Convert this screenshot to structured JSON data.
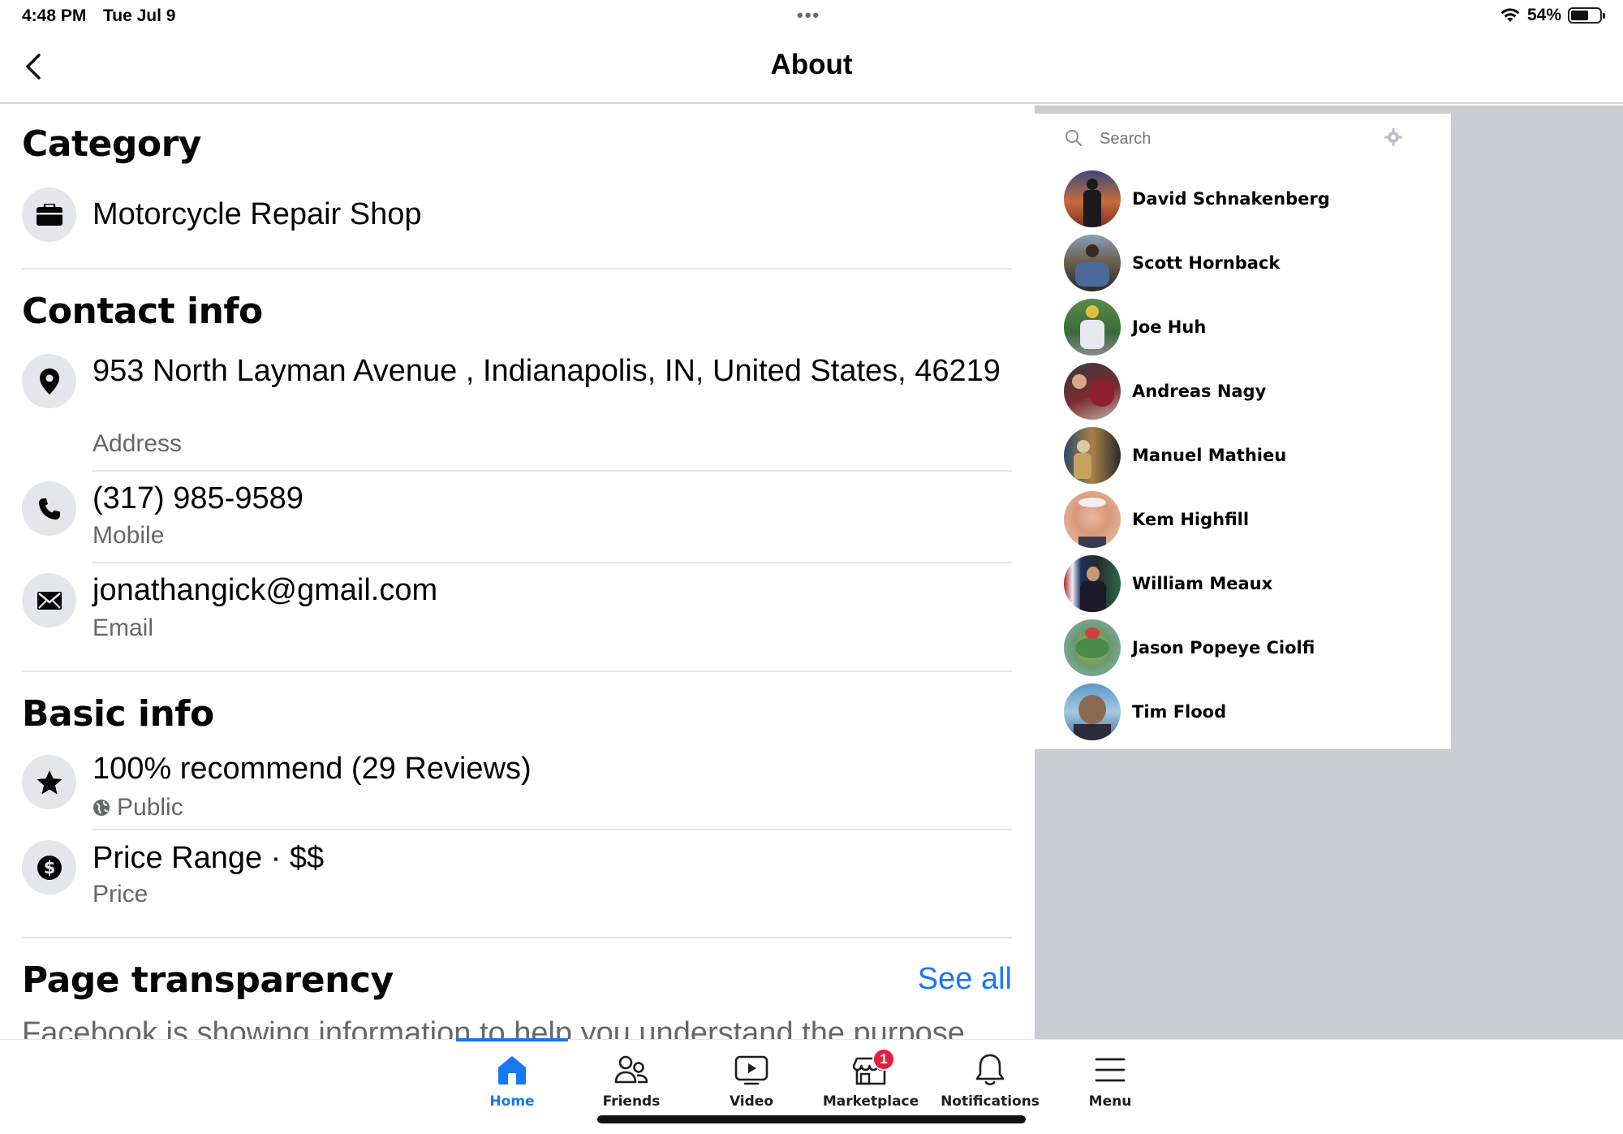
{
  "status_bar": {
    "time": "4:48 PM",
    "date": "Tue Jul 9",
    "battery": "54%"
  },
  "header": {
    "title": "About"
  },
  "category": {
    "title": "Category",
    "value": "Motorcycle Repair Shop"
  },
  "contact": {
    "title": "Contact info",
    "address": "953 North Layman Avenue , Indianapolis, IN, United States, 46219",
    "address_label": "Address",
    "phone": "(317) 985-9589",
    "phone_label": "Mobile",
    "email": "jonathangick@gmail.com",
    "email_label": "Email"
  },
  "basic": {
    "title": "Basic info",
    "rating": "100% recommend (29 Reviews)",
    "rating_label": "Public",
    "price": "Price Range · $$",
    "price_label": "Price"
  },
  "transparency": {
    "title": "Page transparency",
    "see_all": "See all",
    "text": "Facebook is showing information to help you understand the purpose"
  },
  "contacts_panel": {
    "search_placeholder": "Search",
    "friends": [
      {
        "name": "David Schnakenberg"
      },
      {
        "name": "Scott Hornback"
      },
      {
        "name": "Joe Huh"
      },
      {
        "name": "Andreas Nagy"
      },
      {
        "name": "Manuel Mathieu"
      },
      {
        "name": "Kem Highfill"
      },
      {
        "name": "William Meaux"
      },
      {
        "name": "Jason Popeye Ciolfi"
      },
      {
        "name": "Tim Flood"
      }
    ]
  },
  "tabbar": {
    "tabs": [
      {
        "label": "Home"
      },
      {
        "label": "Friends"
      },
      {
        "label": "Video"
      },
      {
        "label": "Marketplace",
        "badge": "1"
      },
      {
        "label": "Notifications"
      },
      {
        "label": "Menu"
      }
    ]
  },
  "colors": {
    "accent": "#1877f2",
    "badge": "#e41e3f",
    "secondary_text": "#65676b"
  }
}
